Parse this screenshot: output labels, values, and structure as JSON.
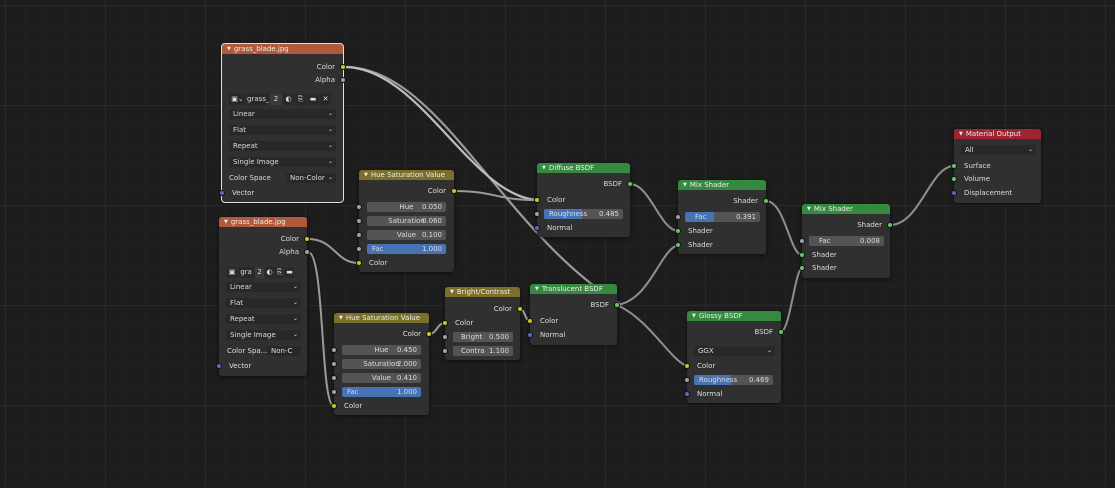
{
  "nodes": {
    "img1": {
      "title": "grass_blade.jpg",
      "out_color": "Color",
      "out_alpha": "Alpha",
      "img_name": "grass_",
      "users": "2",
      "interp": "Linear",
      "proj": "Flat",
      "ext": "Repeat",
      "source": "Single Image",
      "cs_label": "Color Space",
      "cs_value": "Non-Color",
      "vector": "Vector"
    },
    "img2": {
      "title": "grass_blade.jpg",
      "out_color": "Color",
      "out_alpha": "Alpha",
      "img_name": "gra",
      "users": "2",
      "interp": "Linear",
      "proj": "Flat",
      "ext": "Repeat",
      "source": "Single Image",
      "cs_label": "Color Spa...",
      "cs_value": "Non-C",
      "vector": "Vector"
    },
    "hsv1": {
      "title": "Hue Saturation Value",
      "out_color": "Color",
      "hue_label": "Hue",
      "hue": "0.050",
      "sat_label": "Saturation",
      "sat": "0.060",
      "val_label": "Value",
      "val": "0.100",
      "fac_label": "Fac",
      "fac": "1.000",
      "in_color": "Color"
    },
    "hsv2": {
      "title": "Hue Saturation Value",
      "out_color": "Color",
      "hue_label": "Hue",
      "hue": "0.450",
      "sat_label": "Saturation",
      "sat": "2.000",
      "val_label": "Value",
      "val": "0.410",
      "fac_label": "Fac",
      "fac": "1.000",
      "in_color": "Color"
    },
    "bc": {
      "title": "Bright/Contrast",
      "out_color": "Color",
      "in_color": "Color",
      "bright_label": "Bright",
      "bright": "0.500",
      "contrast_label": "Contra",
      "contrast": "1.100"
    },
    "diffuse": {
      "title": "Diffuse BSDF",
      "out": "BSDF",
      "in_color": "Color",
      "rough_label": "Roughness",
      "rough": "0.485",
      "rough_frac": 0.485,
      "normal": "Normal"
    },
    "translucent": {
      "title": "Translucent BSDF",
      "out": "BSDF",
      "in_color": "Color",
      "normal": "Normal"
    },
    "mix1": {
      "title": "Mix Shader",
      "out": "Shader",
      "fac_label": "Fac",
      "fac": "0.391",
      "fac_frac": 0.391,
      "shader1": "Shader",
      "shader2": "Shader"
    },
    "mix2": {
      "title": "Mix Shader",
      "out": "Shader",
      "fac_label": "Fac",
      "fac": "0.008",
      "shader1": "Shader",
      "shader2": "Shader"
    },
    "glossy": {
      "title": "Glossy BSDF",
      "out": "BSDF",
      "dist": "GGX",
      "in_color": "Color",
      "rough_label": "Roughness",
      "rough": "0.469",
      "rough_frac": 0.469,
      "normal": "Normal"
    },
    "output": {
      "title": "Material Output",
      "target": "All",
      "surface": "Surface",
      "volume": "Volume",
      "displacement": "Displacement"
    }
  },
  "colors": {
    "texture_header": "#b4583a",
    "color_header": "#7a702a",
    "shader_header": "#368a3f",
    "output_header": "#9e2431",
    "socket_color": "#c7c729",
    "socket_float": "#a1a1a1",
    "socket_vector": "#6363c7",
    "socket_shader": "#63c763"
  },
  "icons": [
    "image-icon",
    "shield-icon",
    "copy-icon",
    "folder-icon",
    "close-icon",
    "chevron-down-icon"
  ]
}
